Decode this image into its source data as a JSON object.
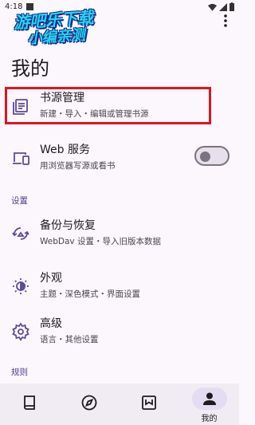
{
  "status_bar": {
    "time": "4:18",
    "icons": [
      "notification-icon",
      "wifi-icon",
      "signal-icon",
      "battery-icon"
    ]
  },
  "watermark": {
    "line1": "游吧乐下载",
    "line2": "小编亲测"
  },
  "page": {
    "title": "我的"
  },
  "items": {
    "book_source": {
      "title": "书源管理",
      "subtitle": "新建・导入・编辑或管理书源",
      "icon": "list-icon"
    },
    "web_service": {
      "title": "Web 服务",
      "subtitle": "用浏览器写源或看书",
      "icon": "devices-icon",
      "enabled": false
    }
  },
  "sections": {
    "settings": {
      "label": "设置",
      "items": [
        {
          "title": "备份与恢复",
          "subtitle": "WebDav 设置・导入旧版本数据",
          "icon": "backup-restore-icon"
        },
        {
          "title": "外观",
          "subtitle": "主题・深色模式・界面设置",
          "icon": "brightness-icon"
        },
        {
          "title": "高级",
          "subtitle": "语言・其他设置",
          "icon": "gear-icon"
        }
      ]
    },
    "rules": {
      "label": "规则"
    }
  },
  "bottom_nav": [
    {
      "name": "bookshelf",
      "icon": "book-icon",
      "label": "",
      "active": false
    },
    {
      "name": "discover",
      "icon": "compass-icon",
      "label": "",
      "active": false
    },
    {
      "name": "rss",
      "icon": "rss-box-icon",
      "label": "",
      "active": false
    },
    {
      "name": "mine",
      "icon": "person-icon",
      "label": "我的",
      "active": true
    }
  ],
  "colors": {
    "accent": "#5b4a9c",
    "highlight_border": "#e0141e",
    "background": "#fcf7fc",
    "nav_background": "#f1ebf3"
  }
}
